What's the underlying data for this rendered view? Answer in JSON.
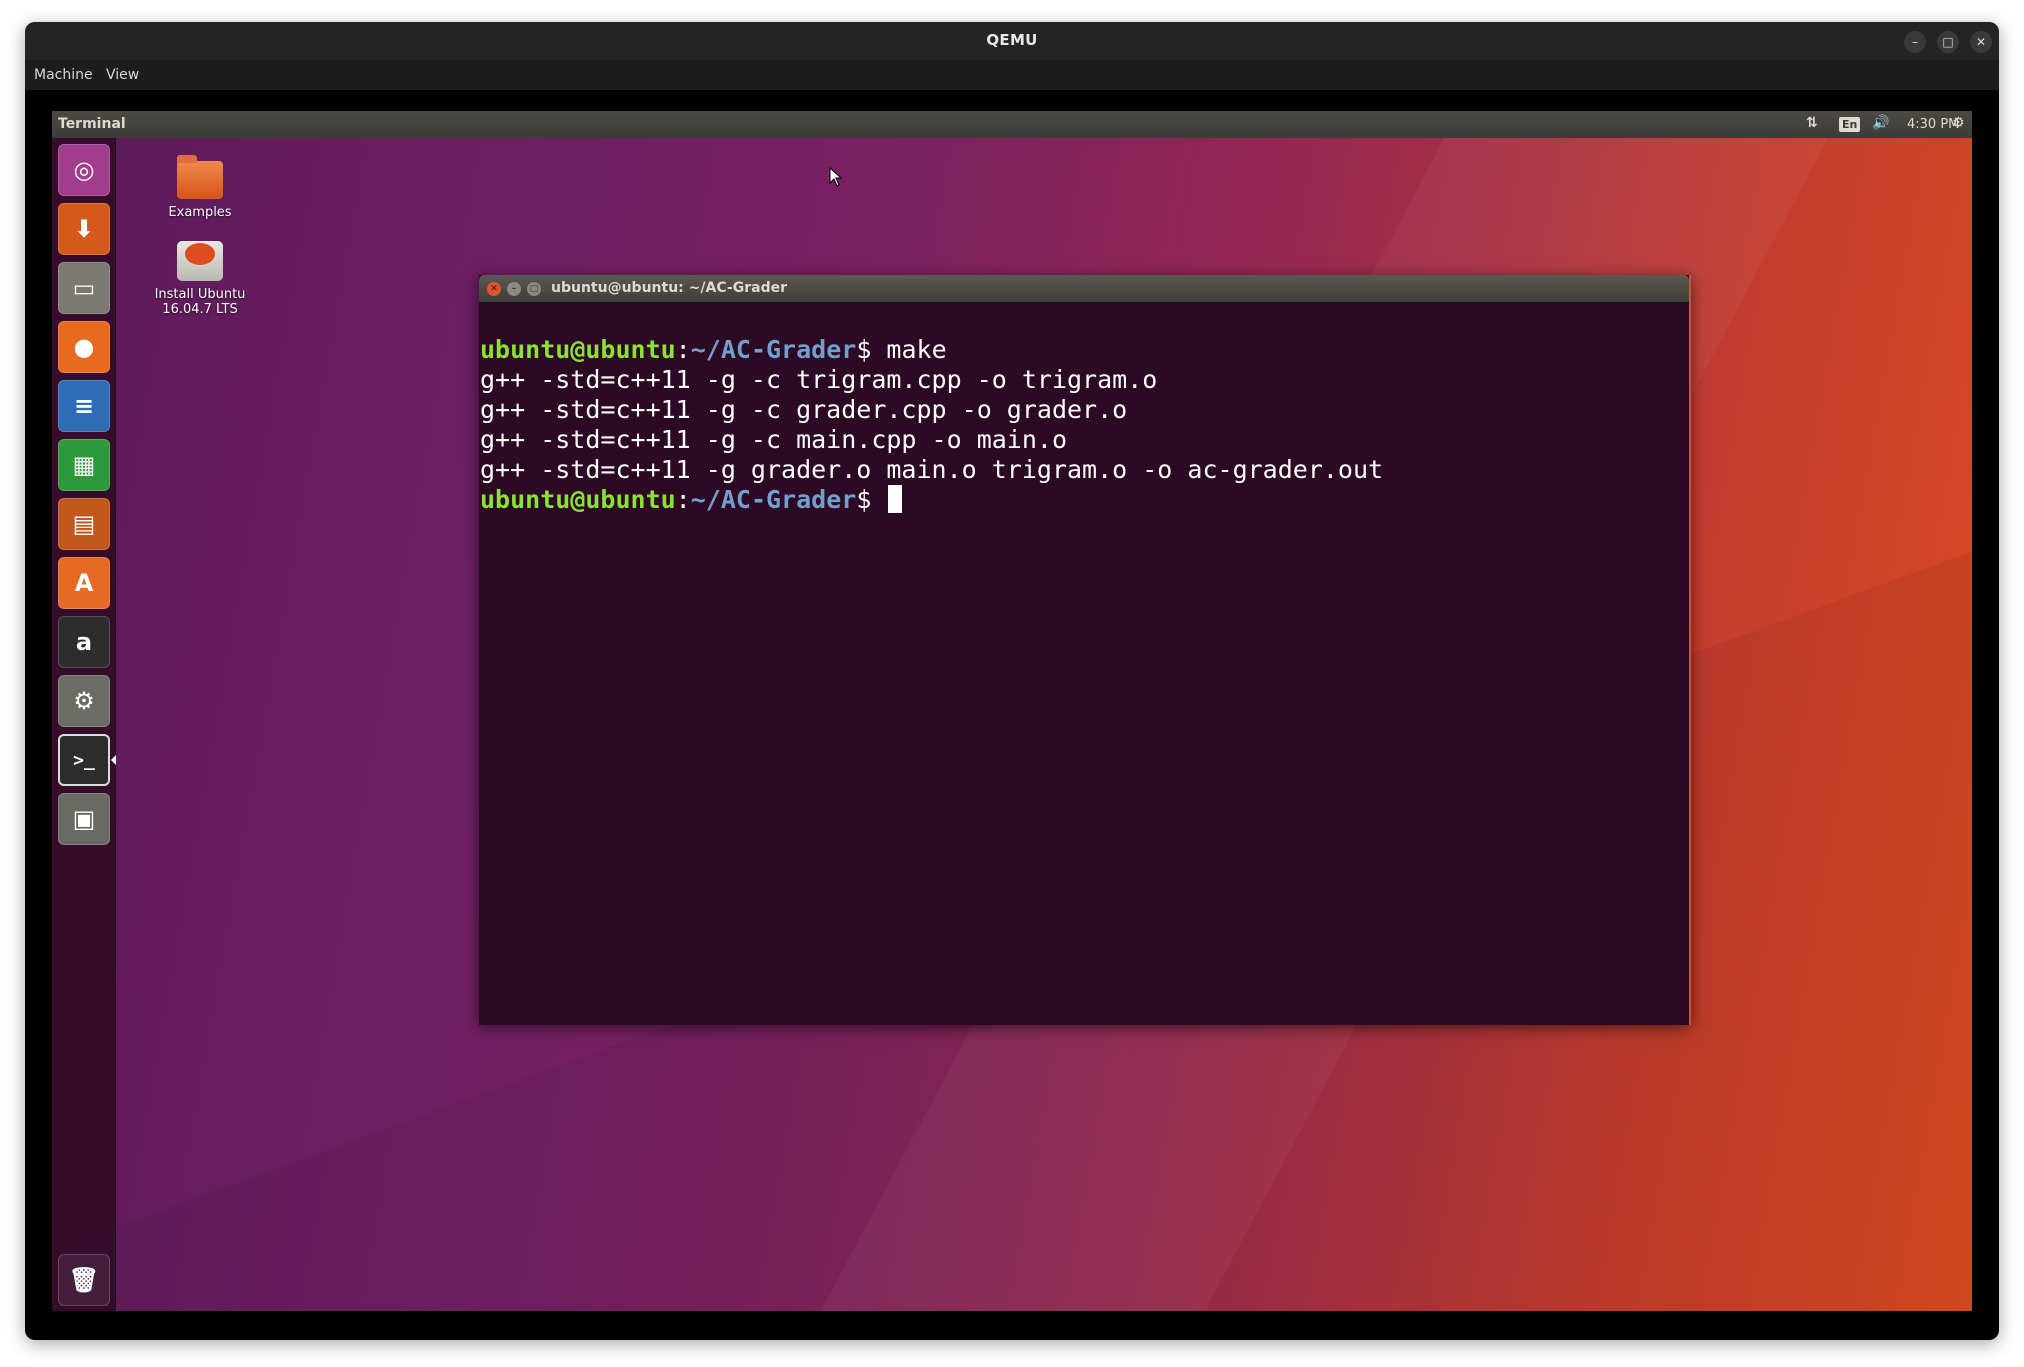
{
  "host_window": {
    "title": "QEMU",
    "menu": [
      "Machine",
      "View"
    ],
    "controls": {
      "minimize": "–",
      "maximize": "□",
      "close": "✕"
    }
  },
  "guest": {
    "topbar": {
      "app_title": "Terminal",
      "indicators": {
        "network": "⇅",
        "keyboard": "En",
        "sound": "🔊",
        "time": "4:30 PM",
        "settings": "⚙"
      }
    },
    "launcher": {
      "items": [
        {
          "name": "dash-ubuntu-icon",
          "glyph": "◎",
          "color": "#a03d8c"
        },
        {
          "name": "install-ubuntu-launcher-icon",
          "glyph": "⬇",
          "color": "#d45a1c"
        },
        {
          "name": "files-icon",
          "glyph": "▭",
          "color": "#7a7a72"
        },
        {
          "name": "firefox-icon",
          "glyph": "●",
          "color": "#e76a1e"
        },
        {
          "name": "libreoffice-writer-icon",
          "glyph": "≡",
          "color": "#2e6db5"
        },
        {
          "name": "libreoffice-calc-icon",
          "glyph": "▦",
          "color": "#2f9a3c"
        },
        {
          "name": "libreoffice-impress-icon",
          "glyph": "▤",
          "color": "#c2581c"
        },
        {
          "name": "software-center-icon",
          "glyph": "A",
          "color": "#e56a24"
        },
        {
          "name": "amazon-icon",
          "glyph": "a",
          "color": "#2d2d2d"
        },
        {
          "name": "system-settings-icon",
          "glyph": "⚙",
          "color": "#6c6c66"
        },
        {
          "name": "terminal-icon",
          "glyph": ">_",
          "color": "#2c2c2c"
        },
        {
          "name": "removable-drive-icon",
          "glyph": "▣",
          "color": "#6a6a64"
        }
      ],
      "trash_glyph": "🗑"
    },
    "desktop_icons": [
      {
        "label": "Examples"
      },
      {
        "label_line1": "Install Ubuntu",
        "label_line2": "16.04.7 LTS"
      }
    ],
    "terminal": {
      "title": "ubuntu@ubuntu: ~/AC-Grader",
      "prompt_user": "ubuntu@ubuntu",
      "prompt_sep": ":",
      "prompt_path": "~/AC-Grader",
      "prompt_suffix": "$ ",
      "command": "make",
      "output": [
        "g++ -std=c++11 -g -c trigram.cpp -o trigram.o",
        "g++ -std=c++11 -g -c grader.cpp -o grader.o",
        "g++ -std=c++11 -g -c main.cpp -o main.o",
        "g++ -std=c++11 -g grader.o main.o trigram.o -o ac-grader.out"
      ]
    }
  }
}
